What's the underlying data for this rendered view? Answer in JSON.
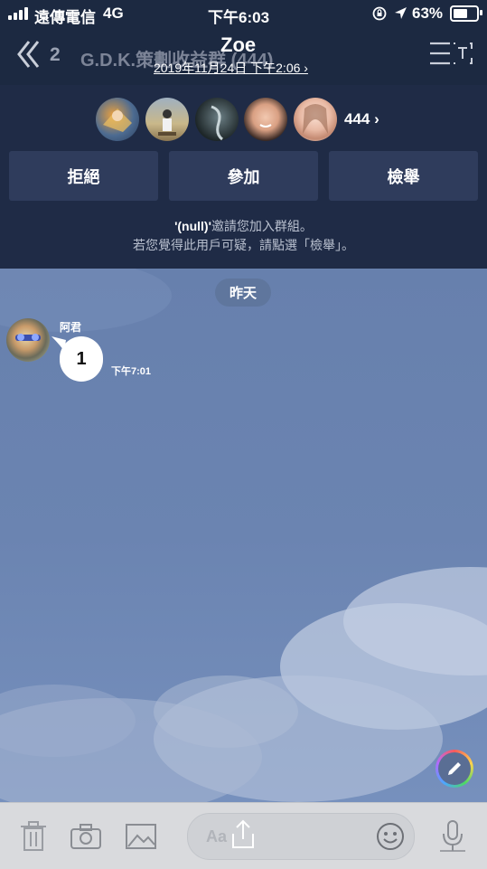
{
  "status_bar": {
    "carrier": "遠傳電信",
    "network": "4G",
    "time": "下午6:03",
    "battery": "63%"
  },
  "header": {
    "back_count": "2",
    "group_title": "G.D.K.策劃收益群 (444)",
    "sender_name": "Zoe",
    "invite_date": "2019年11月24日 下午2:06 ›"
  },
  "invite": {
    "member_count": "444 ›",
    "buttons": {
      "reject": "拒絕",
      "join": "參加",
      "report": "檢舉"
    },
    "message_line1_name": "'(null)'",
    "message_line1_rest": "邀請您加入群組。",
    "message_line2": "若您覺得此用戶可疑，請點選「檢舉」。"
  },
  "chat": {
    "date_chip": "昨天",
    "messages": [
      {
        "sender": "阿君",
        "text": "1",
        "time": "下午7:01"
      }
    ]
  },
  "input": {
    "placeholder": "Aa"
  },
  "colors": {
    "header_bg": "#1c2941",
    "invite_bg": "#1f2b46",
    "button_bg": "#2f3c5c",
    "chat_bg": "#6d86b3"
  }
}
